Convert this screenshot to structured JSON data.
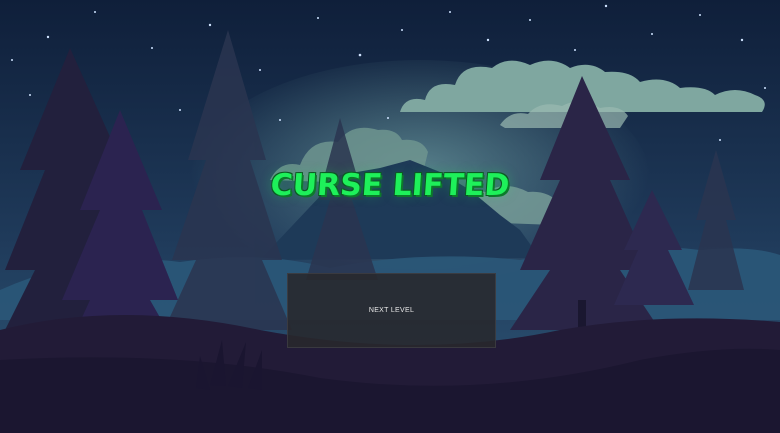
{
  "game": {
    "title": "CURSE LIFTED",
    "next_level_label": "NEXT LEVEL"
  },
  "colors": {
    "sky_top": "#0f1f3a",
    "sky_bottom": "#2c4a6a",
    "title_green": "#1ef05a",
    "button_bg": "#28282c",
    "cloud": "#7fa7a0",
    "tree_dark": "#25223f",
    "ground": "#241d3a"
  }
}
